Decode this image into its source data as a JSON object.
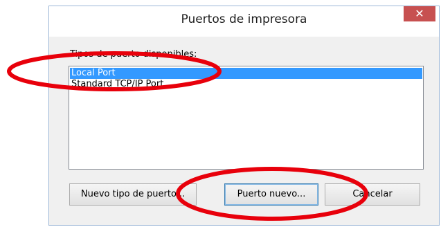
{
  "window": {
    "title": "Puertos de impresora",
    "close_glyph": "✕"
  },
  "port_list": {
    "label": "Tipos de puerto disponibles:",
    "items": [
      {
        "label": "Local Port",
        "selected": true
      },
      {
        "label": "Standard TCP/IP Port",
        "selected": false
      }
    ]
  },
  "buttons": {
    "new_port_type": "Nuevo tipo de puerto...",
    "new_port": "Puerto nuevo...",
    "cancel": "Cancelar"
  },
  "colors": {
    "selection": "#3399ff",
    "close_button": "#c75050",
    "annotation": "#e8000b"
  }
}
